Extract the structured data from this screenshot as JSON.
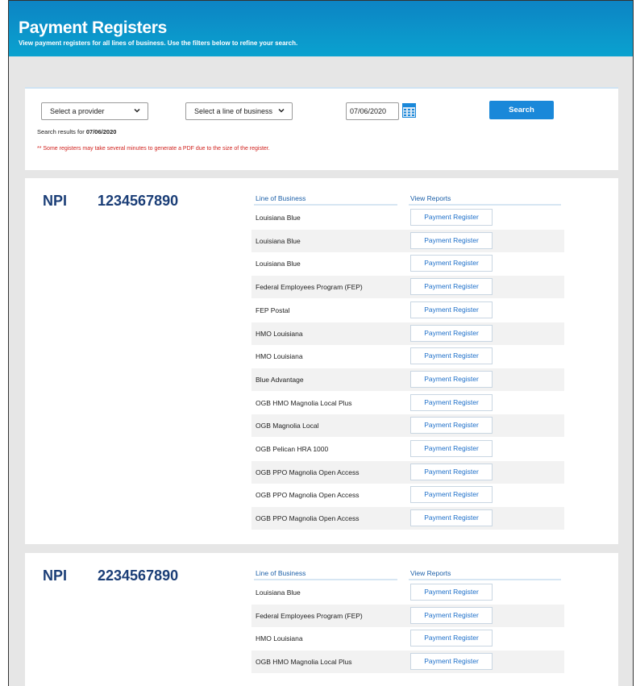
{
  "header": {
    "title": "Payment Registers",
    "subtitle": "View payment registers for all lines of business. Use the filters below to refine your search."
  },
  "filters": {
    "provider_select": "Select a provider",
    "lob_select": "Select a line of business",
    "date": "07/06/2020",
    "search_button": "Search",
    "results_prefix": "Search results for",
    "results_date": "07/06/2020",
    "warning": "** Some registers may take several minutes to generate a PDF due to the size of the register."
  },
  "columns": {
    "lob": "Line of Business",
    "reports": "View Reports"
  },
  "action_label": "Payment Register",
  "providers": [
    {
      "npi_label": "NPI",
      "npi": "1234567890",
      "lines": [
        "Louisiana Blue",
        "Louisiana Blue",
        "Louisiana Blue",
        "Federal Employees Program (FEP)",
        "FEP Postal",
        "HMO Louisiana",
        "HMO Louisiana",
        "Blue Advantage",
        "OGB HMO Magnolia Local Plus",
        "OGB Magnolia Local",
        "OGB Pelican HRA 1000",
        "OGB PPO Magnolia Open Access",
        "OGB PPO Magnolia Open Access",
        "OGB PPO Magnolia Open Access"
      ]
    },
    {
      "npi_label": "NPI",
      "npi": "2234567890",
      "lines": [
        "Louisiana Blue",
        "Federal Employees Program (FEP)",
        "HMO Louisiana",
        "OGB HMO Magnolia Local Plus"
      ]
    }
  ],
  "colors": {
    "banner": "#0d84c4",
    "accent": "#1a88d9",
    "npi_text": "#1b3e77",
    "warning": "#d0201c"
  }
}
